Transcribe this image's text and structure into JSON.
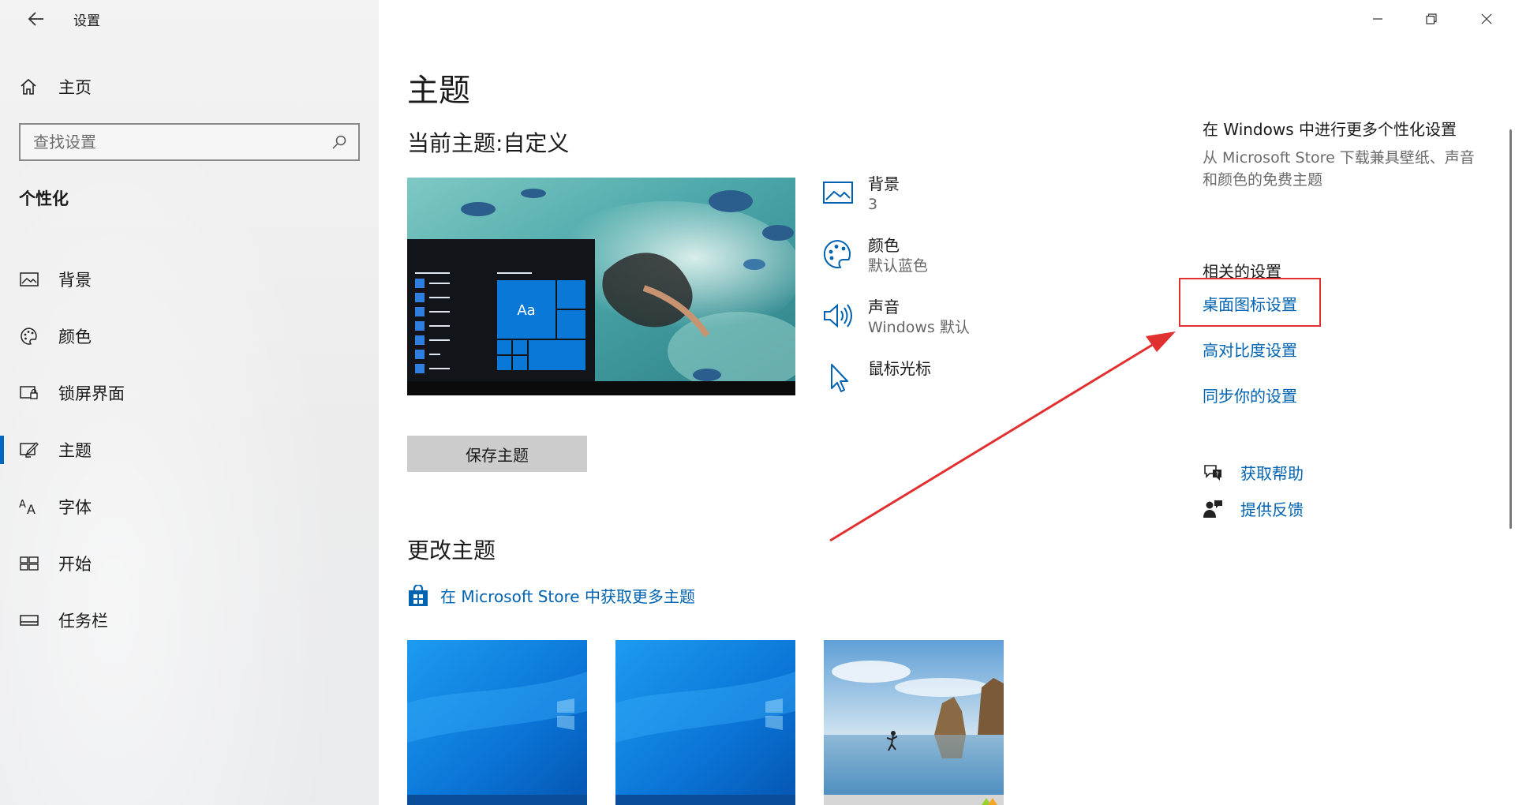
{
  "window": {
    "title": "设置"
  },
  "sidebar": {
    "home_label": "主页",
    "search_placeholder": "查找设置",
    "section_label": "个性化",
    "items": [
      {
        "label": "背景",
        "icon": "picture-icon"
      },
      {
        "label": "颜色",
        "icon": "palette-icon"
      },
      {
        "label": "锁屏界面",
        "icon": "lock-screen-icon"
      },
      {
        "label": "主题",
        "icon": "theme-icon",
        "active": true
      },
      {
        "label": "字体",
        "icon": "font-icon"
      },
      {
        "label": "开始",
        "icon": "start-icon"
      },
      {
        "label": "任务栏",
        "icon": "taskbar-icon"
      }
    ]
  },
  "main": {
    "title": "主题",
    "current_theme": "当前主题:自定义",
    "preview_tile_label": "Aa",
    "properties": [
      {
        "name": "背景",
        "value": "3",
        "icon": "picture-icon"
      },
      {
        "name": "颜色",
        "value": "默认蓝色",
        "icon": "palette-icon"
      },
      {
        "name": "声音",
        "value": "Windows 默认",
        "icon": "speaker-icon"
      },
      {
        "name": "鼠标光标",
        "value": "",
        "icon": "cursor-icon"
      }
    ],
    "save_button": "保存主题",
    "change_title": "更改主题",
    "store_link": "在 Microsoft Store 中获取更多主题"
  },
  "right": {
    "heading": "在 Windows 中进行更多个性化设置",
    "description": "从 Microsoft Store 下载兼具壁纸、声音和颜色的免费主题",
    "related_title": "相关的设置",
    "links": [
      "桌面图标设置",
      "高对比度设置",
      "同步你的设置"
    ],
    "help": "获取帮助",
    "feedback": "提供反馈"
  },
  "colors": {
    "accent": "#0078d7",
    "link": "#0063b1",
    "annotation": "#e03030"
  }
}
